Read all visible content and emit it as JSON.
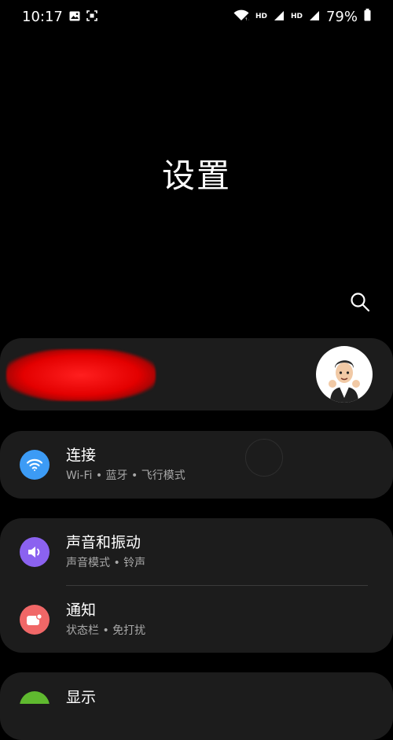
{
  "status_bar": {
    "time": "10:17",
    "hd1": "HD",
    "hd2": "HD",
    "battery": "79%"
  },
  "header": {
    "title": "设置"
  },
  "items": [
    {
      "title": "连接",
      "subtitle": "Wi-Fi • 蓝牙 • 飞行模式",
      "icon": "wifi-icon",
      "color": "#3c9bf5"
    },
    {
      "title": "声音和振动",
      "subtitle": "声音模式 • 铃声",
      "icon": "speaker-icon",
      "color": "#8b62f0"
    },
    {
      "title": "通知",
      "subtitle": "状态栏 • 免打扰",
      "icon": "notification-icon",
      "color": "#f06767"
    },
    {
      "title": "显示",
      "icon": "display-icon",
      "color": "#5fb92f"
    }
  ]
}
